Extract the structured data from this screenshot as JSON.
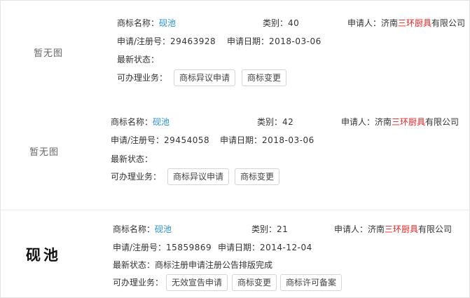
{
  "labels": {
    "name": "商标名称：",
    "category": "类别：",
    "applicant": "申请人：",
    "reg_no": "申请/注册号：",
    "apply_date": "申请日期：",
    "status": "最新状态：",
    "business": "可办理业务："
  },
  "records": [
    {
      "image_text": "暂无图",
      "name": "砚池",
      "category": "40",
      "applicant_pre": "济南",
      "applicant_hl": "三环厨具",
      "applicant_post": "有限公司",
      "reg_no": "29463928",
      "apply_date": "2018-03-06",
      "status": "",
      "buttons": [
        "商标异议申请",
        "商标变更"
      ]
    },
    {
      "image_text": "暂无图",
      "name": "砚池",
      "category": "42",
      "applicant_pre": "济南",
      "applicant_hl": "三环厨具",
      "applicant_post": "有限公司",
      "reg_no": "29454058",
      "apply_date": "2018-03-06",
      "status": "",
      "buttons": [
        "商标异议申请",
        "商标变更"
      ]
    },
    {
      "image_text": "砚池",
      "name": "砚池",
      "category": "21",
      "applicant_pre": "济南",
      "applicant_hl": "三环厨具",
      "applicant_post": "有限公司",
      "reg_no": "15859869",
      "apply_date": "2014-12-04",
      "status": "商标注册申请注册公告排版完成",
      "buttons": [
        "无效宣告申请",
        "商标变更",
        "商标许可备案"
      ]
    }
  ],
  "colors": {
    "link": "#2a8fc7",
    "highlight": "#e02020",
    "text": "#333333",
    "button_border": "#d6d6d6"
  }
}
